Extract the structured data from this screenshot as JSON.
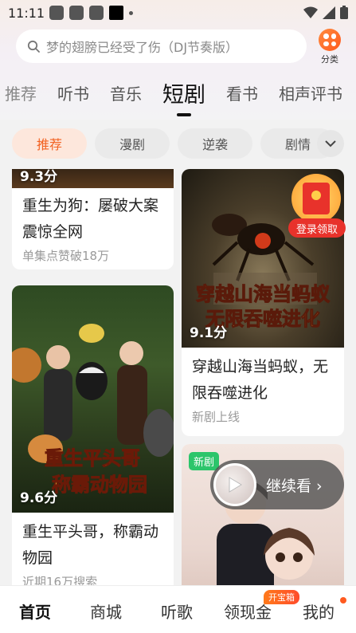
{
  "status_bar": {
    "time": "11:11"
  },
  "search": {
    "placeholder": "梦的翅膀已经受了伤（DJ节奏版）"
  },
  "category_button": {
    "label": "分类"
  },
  "top_tabs": [
    "推荐",
    "听书",
    "音乐",
    "短剧",
    "看书",
    "相声评书"
  ],
  "active_tab": "短剧",
  "filter_chips": [
    "推荐",
    "漫剧",
    "逆袭",
    "剧情"
  ],
  "active_chip": "推荐",
  "cards": [
    {
      "score": "9.3分",
      "title": "重生为狗：屡破大案震惊全网",
      "subtitle": "单集点赞破18万"
    },
    {
      "score": "9.1分",
      "title": "穿越山海当蚂蚁，无限吞噬进化",
      "subtitle": "新剧上线",
      "poster_text": "穿越山海当蚂蚁 无限吞噬进化"
    },
    {
      "score": "9.6分",
      "title": "重生平头哥，称霸动物园",
      "subtitle": "近期16万搜索",
      "poster_text": "重生平头哥 称霸动物园"
    },
    {
      "badge": "新剧"
    }
  ],
  "floating": {
    "red_packet_label": "登录领取",
    "continue_label": "继续看 ›"
  },
  "bottom_nav": {
    "items": [
      "首页",
      "商城",
      "听歌",
      "领现金",
      "我的"
    ],
    "active": "首页",
    "cash_badge": "开宝箱"
  },
  "colors": {
    "accent": "#f26222",
    "chip_active_bg": "#fde7dc",
    "new_badge": "#2cc56b",
    "red_packet": "#e8322b"
  }
}
